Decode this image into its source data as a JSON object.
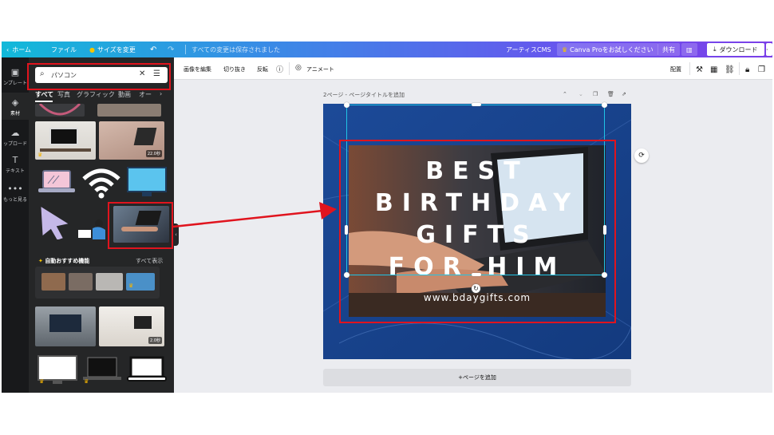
{
  "topbar": {
    "home": "ホーム",
    "file": "ファイル",
    "resize": "サイズを変更",
    "undo_icon": "undo-icon",
    "redo_icon": "redo-icon",
    "save_status": "すべての変更は保存されました",
    "artist": "アーティスCMS",
    "try_pro": "Canva Proをお試しください",
    "share": "共有",
    "download": "ダウンロード"
  },
  "rail": {
    "items": [
      {
        "label": "ンプレート",
        "icon": "template-icon"
      },
      {
        "label": "素材",
        "icon": "elements-icon"
      },
      {
        "label": "ップロード",
        "icon": "upload-icon"
      },
      {
        "label": "テキスト",
        "icon": "text-icon"
      },
      {
        "label": "もっと見る",
        "icon": "more-icon"
      }
    ]
  },
  "panel": {
    "search_value": "パソコン",
    "tabs": [
      "すべて",
      "写真",
      "グラフィック",
      "動画",
      "オー"
    ],
    "badges": {
      "video1": "22.0秒",
      "video2": "2.0秒"
    },
    "section_title": "自動おすすめ機能",
    "section_more": "すべて表示"
  },
  "toolbar": {
    "edit_image": "画像を編集",
    "crop": "切り抜き",
    "flip": "反転",
    "animate": "アニメート",
    "arrange": "配置"
  },
  "page": {
    "title": "2ページ - ページタイトルを追加",
    "add_page": "+ページを追加"
  },
  "design": {
    "headline_lines": [
      "BEST",
      "BIRTHDAY",
      "GIFTS",
      "FOR HIM"
    ],
    "url": "www.bdaygifts.com"
  },
  "colors": {
    "accent": "#20c4e6",
    "annotation": "#e0141e",
    "design_bg": "#17408a"
  }
}
